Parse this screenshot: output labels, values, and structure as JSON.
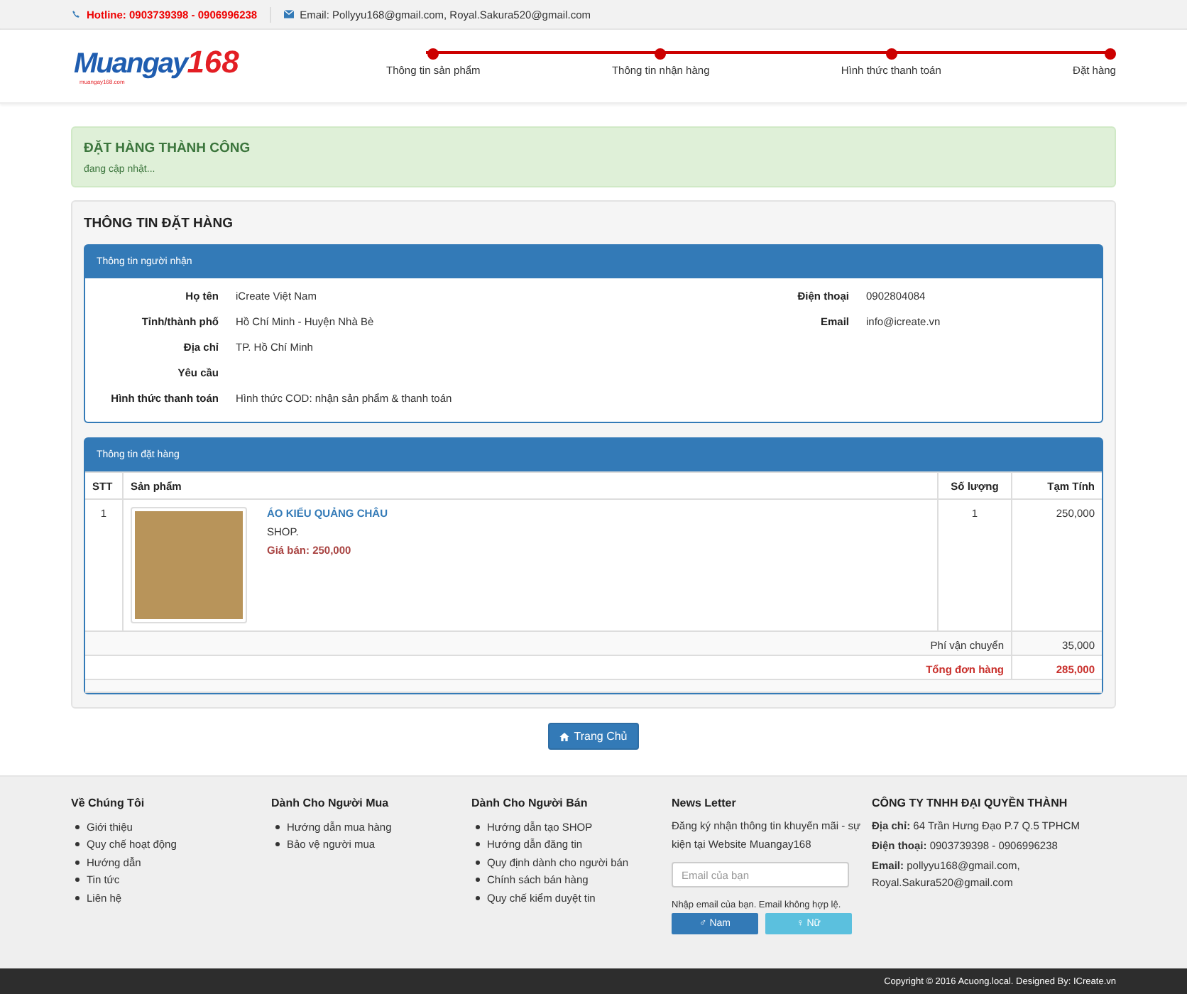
{
  "topbar": {
    "hotline": "Hotline: 0903739398 - 0906996238",
    "email": "Email: Pollyyu168@gmail.com, Royal.Sakura520@gmail.com"
  },
  "logo": {
    "name": "Muangay",
    "number": "168",
    "domain": "muangay168.com"
  },
  "steps": [
    {
      "label": "Thông tin sản phẩm",
      "done": true
    },
    {
      "label": "Thông tin nhận hàng",
      "done": true
    },
    {
      "label": "Hình thức thanh toán",
      "done": true
    },
    {
      "label": "Đặt hàng",
      "done": true
    }
  ],
  "alert": {
    "title": "ĐẶT HÀNG THÀNH CÔNG",
    "message": "đang cập nhật..."
  },
  "order_panel": {
    "title": "THÔNG TIN ĐẶT HÀNG"
  },
  "recipient": {
    "title": "Thông tin người nhận",
    "rows": [
      {
        "label": "Họ tên",
        "value": "iCreate Việt Nam",
        "label_2": "Điện thoại",
        "value_2": "0902804084"
      },
      {
        "label": "Tỉnh/thành phố",
        "value": "Hồ Chí Minh  -  Huyện Nhà Bè",
        "label_2": "Email",
        "value_2": "info@icreate.vn"
      },
      {
        "label": "Địa chỉ",
        "value": "TP. Hồ Chí Minh"
      },
      {
        "label": "Yêu cầu"
      },
      {
        "label": "Hình thức thanh toán",
        "value": "Hình thức COD: nhận sản phẩm & thanh toán"
      }
    ]
  },
  "order": {
    "title": "Thông tin đặt hàng",
    "columns": [
      "STT",
      "Sản phẩm",
      "Số lượng",
      "Tạm Tính"
    ],
    "rows": [
      {
        "index": "1",
        "name": "ÁO KIỂU QUẢNG CHÂU",
        "shop": "SHOP.",
        "price": "Giá bán: 250,000",
        "quantity": "1",
        "subtotal": "250,000"
      }
    ],
    "shipping_label": "Phí vận chuyển",
    "shipping": "35,000",
    "total_label": "Tổng đơn hàng",
    "total": "285,000"
  },
  "home_button": "Trang Chủ",
  "footer": {
    "columns": [
      {
        "title": "Về Chúng Tôi",
        "links": [
          "Giới thiệu",
          "Quy chế hoạt động",
          "Hướng dẫn",
          "Tin tức",
          "Liên hệ"
        ]
      },
      {
        "title": "Dành Cho Người Mua",
        "links": [
          "Hướng dẫn mua hàng",
          "Bảo vệ người mua"
        ]
      },
      {
        "title": "Dành Cho Người Bán",
        "links": [
          "Hướng dẫn tạo SHOP",
          "Hướng dẫn đăng tin",
          "Quy định dành cho người bán",
          "Chính sách bán hàng",
          "Quy chế kiểm duyệt tin"
        ]
      }
    ],
    "newsletter": {
      "title": "News Letter",
      "text": "Đăng ký nhận thông tin khuyến mãi - sự kiện tại Website Muangay168",
      "placeholder": "Email của bạn",
      "hint": "Nhập email của bạn. Email không hợp lệ.",
      "buttons": [
        {
          "label": "♂ Nam",
          "kind": "primary"
        },
        {
          "label": "♀ Nữ",
          "kind": "info"
        }
      ]
    },
    "company": {
      "title": "CÔNG TY TNHH ĐẠI QUYỀN THÀNH",
      "lines": [
        "**Địa chỉ:** 64 Trần Hưng Đạo P.7 Q.5 TPHCM",
        "**Điện thoại:** 0903739398 - 0906996238",
        "**Email:** pollyyu168@gmail.com, Royal.Sakura520@gmail.com"
      ]
    }
  },
  "copyright": "Copyright © 2016 Acuong.local. Designed By: ICreate.vn"
}
